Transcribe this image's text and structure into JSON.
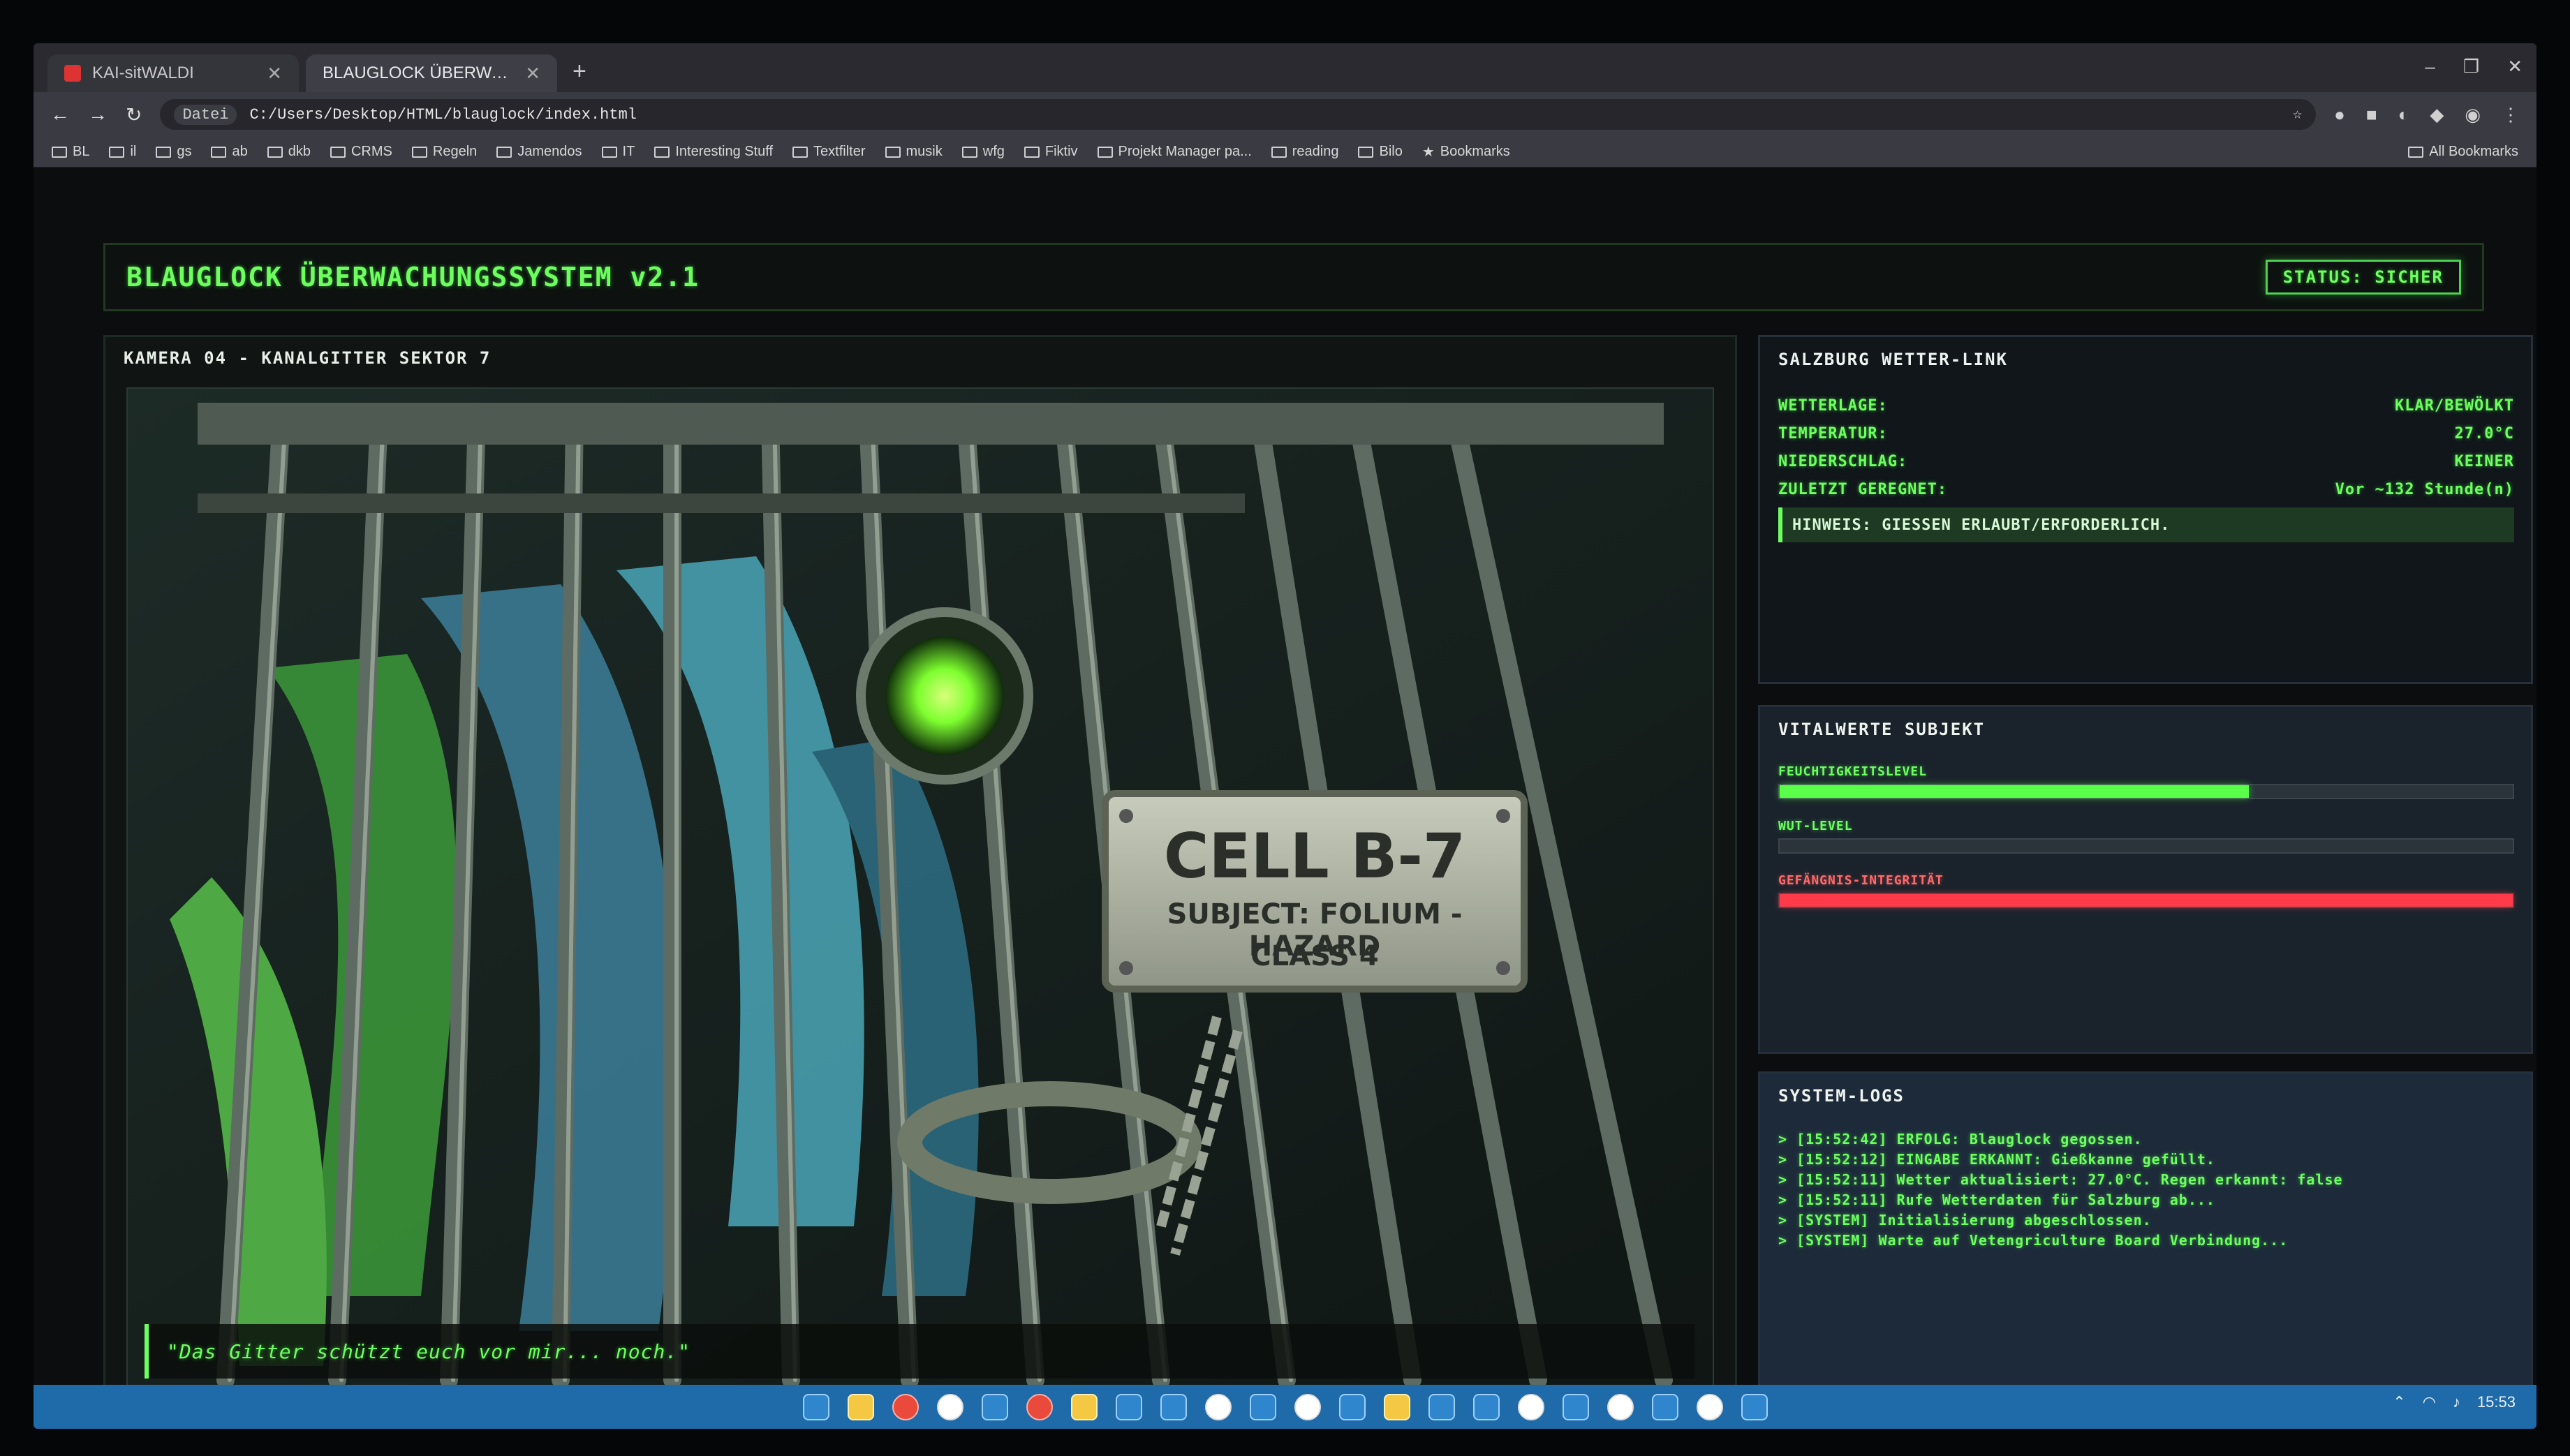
{
  "browser": {
    "tabs": [
      {
        "label": "KAI-sitWALDI",
        "active": false
      },
      {
        "label": "BLAUGLOCK ÜBERWACHUNGS",
        "active": true
      }
    ],
    "address": "C:/Users/Desktop/HTML/blauglock/index.html",
    "address_chip": "Datei",
    "bookmarks": [
      "BL",
      "il",
      "gs",
      "ab",
      "dkb",
      "CRMS",
      "Regeln",
      "Jamendos",
      "IT",
      "Interesting Stuff",
      "Textfilter",
      "musik",
      "wfg",
      "Fiktiv",
      "Projekt Manager pa...",
      "reading",
      "Bilo",
      "Bookmarks"
    ],
    "all_bookmarks": "All Bookmarks"
  },
  "app": {
    "title": "BLAUGLOCK ÜBERWACHUNGSSYSTEM v2.1",
    "status": "STATUS: SICHER",
    "accent": "#6dff5e",
    "camera": {
      "label": "KAMERA 04 - KANALGITTER SEKTOR 7",
      "sign": {
        "title": "CELL B-7",
        "subtitle": "SUBJECT: FOLIUM - HAZARD",
        "class": "CLASS 4"
      },
      "quote": "\"Das Gitter schützt euch vor mir... noch.\""
    },
    "weather": {
      "title": "SALZBURG WETTER-LINK",
      "rows": [
        {
          "key": "WETTERLAGE:",
          "value": "KLAR/BEWÖLKT"
        },
        {
          "key": "TEMPERATUR:",
          "value": "27.0°C"
        },
        {
          "key": "NIEDERSCHLAG:",
          "value": "KEINER"
        },
        {
          "key": "ZULETZT GEREGNET:",
          "value": "Vor ~132 Stunde(n)"
        }
      ],
      "hint": "HINWEIS: GIESSEN ERLAUBT/ERFORDERLICH."
    },
    "vitals": {
      "title": "VITALWERTE SUBJEKT",
      "bars": [
        {
          "label": "FEUCHTIGKEITSLEVEL",
          "level": 0.64,
          "color": "#5aff4a"
        },
        {
          "label": "WUT-LEVEL",
          "level": 0.0,
          "color": "#5aff4a"
        },
        {
          "label": "GEFÄNGNIS-INTEGRITÄT",
          "level": 1.0,
          "color": "#ff3b4a"
        }
      ]
    },
    "logs": {
      "title": "SYSTEM-LOGS",
      "entries": [
        "> [15:52:42] ERFOLG: Blauglock gegossen.",
        "> [15:52:12] EINGABE ERKANNT: Gießkanne gefüllt.",
        "> [15:52:11] Wetter aktualisiert: 27.0°C. Regen erkannt: false",
        "> [15:52:11] Rufe Wetterdaten für Salzburg ab...",
        "> [SYSTEM] Initialisierung abgeschlossen.",
        "> [SYSTEM] Warte auf Vetengriculture Board Verbindung..."
      ]
    }
  },
  "taskbar": {
    "clock": "15:53"
  }
}
